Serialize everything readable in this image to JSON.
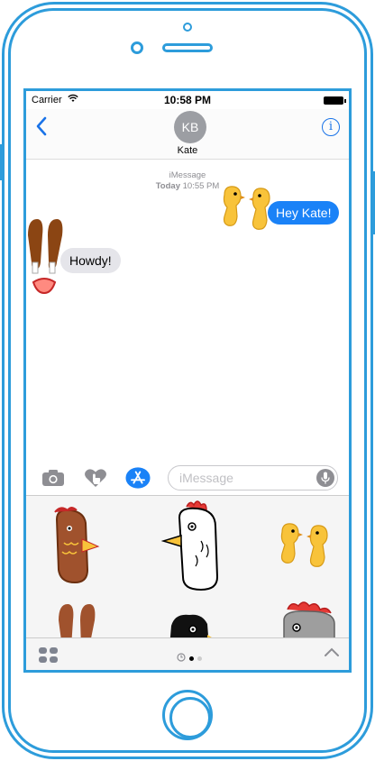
{
  "status_bar": {
    "carrier": "Carrier",
    "time": "10:58 PM"
  },
  "nav": {
    "avatar_initials": "KB",
    "contact_name": "Kate"
  },
  "conversation": {
    "service": "iMessage",
    "day": "Today",
    "time": "10:55 PM",
    "messages": [
      {
        "from": "me",
        "text": "Hey Kate!"
      },
      {
        "from": "them",
        "text": "Howdy!"
      }
    ]
  },
  "composer": {
    "placeholder": "iMessage"
  },
  "colors": {
    "accent": "#1a73e8",
    "outgoing_bubble": "#1a82f7",
    "frame": "#2d9cdb"
  },
  "icons": [
    "chevron-left-icon",
    "info-icon",
    "camera-icon",
    "digital-touch-icon",
    "app-store-icon",
    "microphone-icon",
    "app-drawer-icon",
    "recents-icon",
    "chevron-up-icon"
  ]
}
